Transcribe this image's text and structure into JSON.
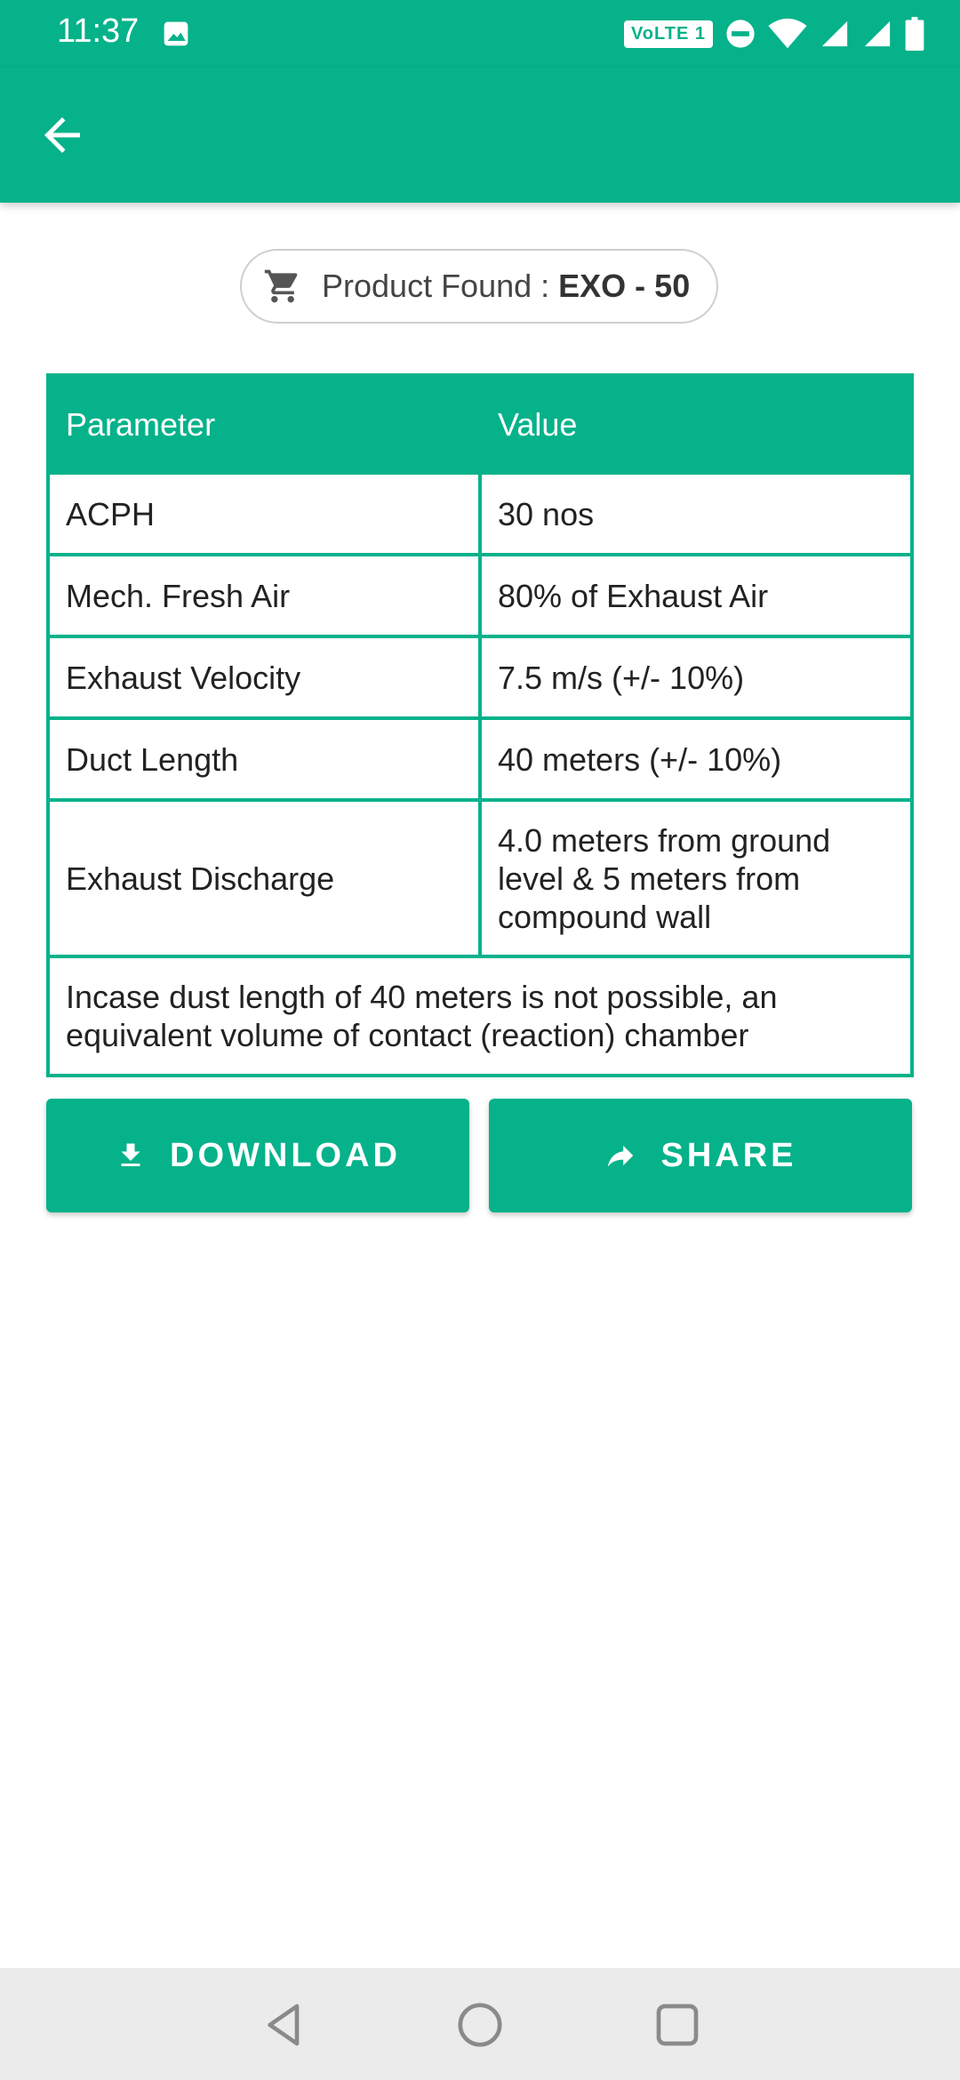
{
  "status_bar": {
    "time": "11:37",
    "volte_label": "VoLTE 1",
    "icons": [
      "image-icon",
      "volte-icon",
      "do-not-disturb-icon",
      "wifi-icon",
      "signal-icon",
      "signal-icon",
      "battery-icon"
    ]
  },
  "app_bar": {
    "back_icon": "arrow-back-icon"
  },
  "product": {
    "icon": "cart-icon",
    "label": "Product Found : ",
    "name": "EXO - 50"
  },
  "table": {
    "headers": [
      "Parameter",
      "Value"
    ],
    "rows": [
      {
        "parameter": "ACPH",
        "value": "30 nos"
      },
      {
        "parameter": "Mech. Fresh Air",
        "value": "80% of Exhaust Air"
      },
      {
        "parameter": "Exhaust Velocity",
        "value": "7.5 m/s (+/- 10%)"
      },
      {
        "parameter": "Duct Length",
        "value": "40 meters (+/- 10%)"
      },
      {
        "parameter": "Exhaust Discharge",
        "value": "4.0 meters from ground level & 5 meters from compound wall"
      }
    ],
    "note": "Incase dust length of 40 meters is not possible, an equivalent volume of contact (reaction) chamber"
  },
  "buttons": {
    "download_label": "DOWNLOAD",
    "share_label": "SHARE"
  },
  "colors": {
    "accent": "#05b28a",
    "nav_bar": "#ebebeb"
  }
}
